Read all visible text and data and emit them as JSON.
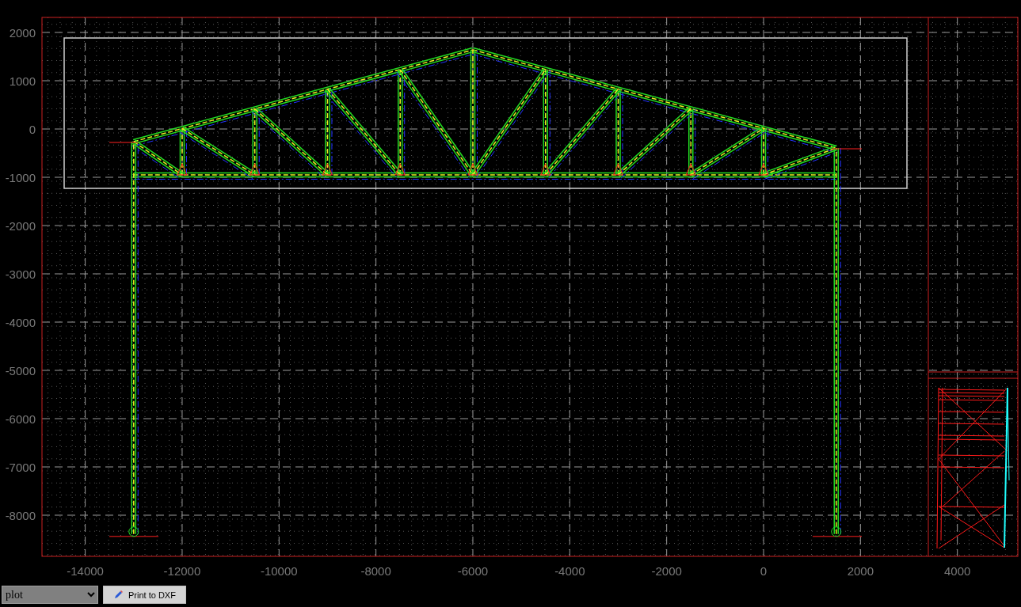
{
  "plot": {
    "y_axis_labels": [
      "2000",
      "1000",
      "0",
      "-1000",
      "-2000",
      "-3000",
      "-4000",
      "-5000",
      "-6000",
      "-7000",
      "-8000"
    ],
    "x_axis_labels": [
      "-14000",
      "-12000",
      "-10000",
      "-8000",
      "-6000",
      "-4000",
      "-2000",
      "0",
      "2000"
    ]
  },
  "side_view": {
    "x_axis_labels": [
      "4000"
    ]
  },
  "toolbar": {
    "view_select": {
      "value": "plot"
    },
    "print_button": {
      "label": "Print to DXF"
    }
  }
}
